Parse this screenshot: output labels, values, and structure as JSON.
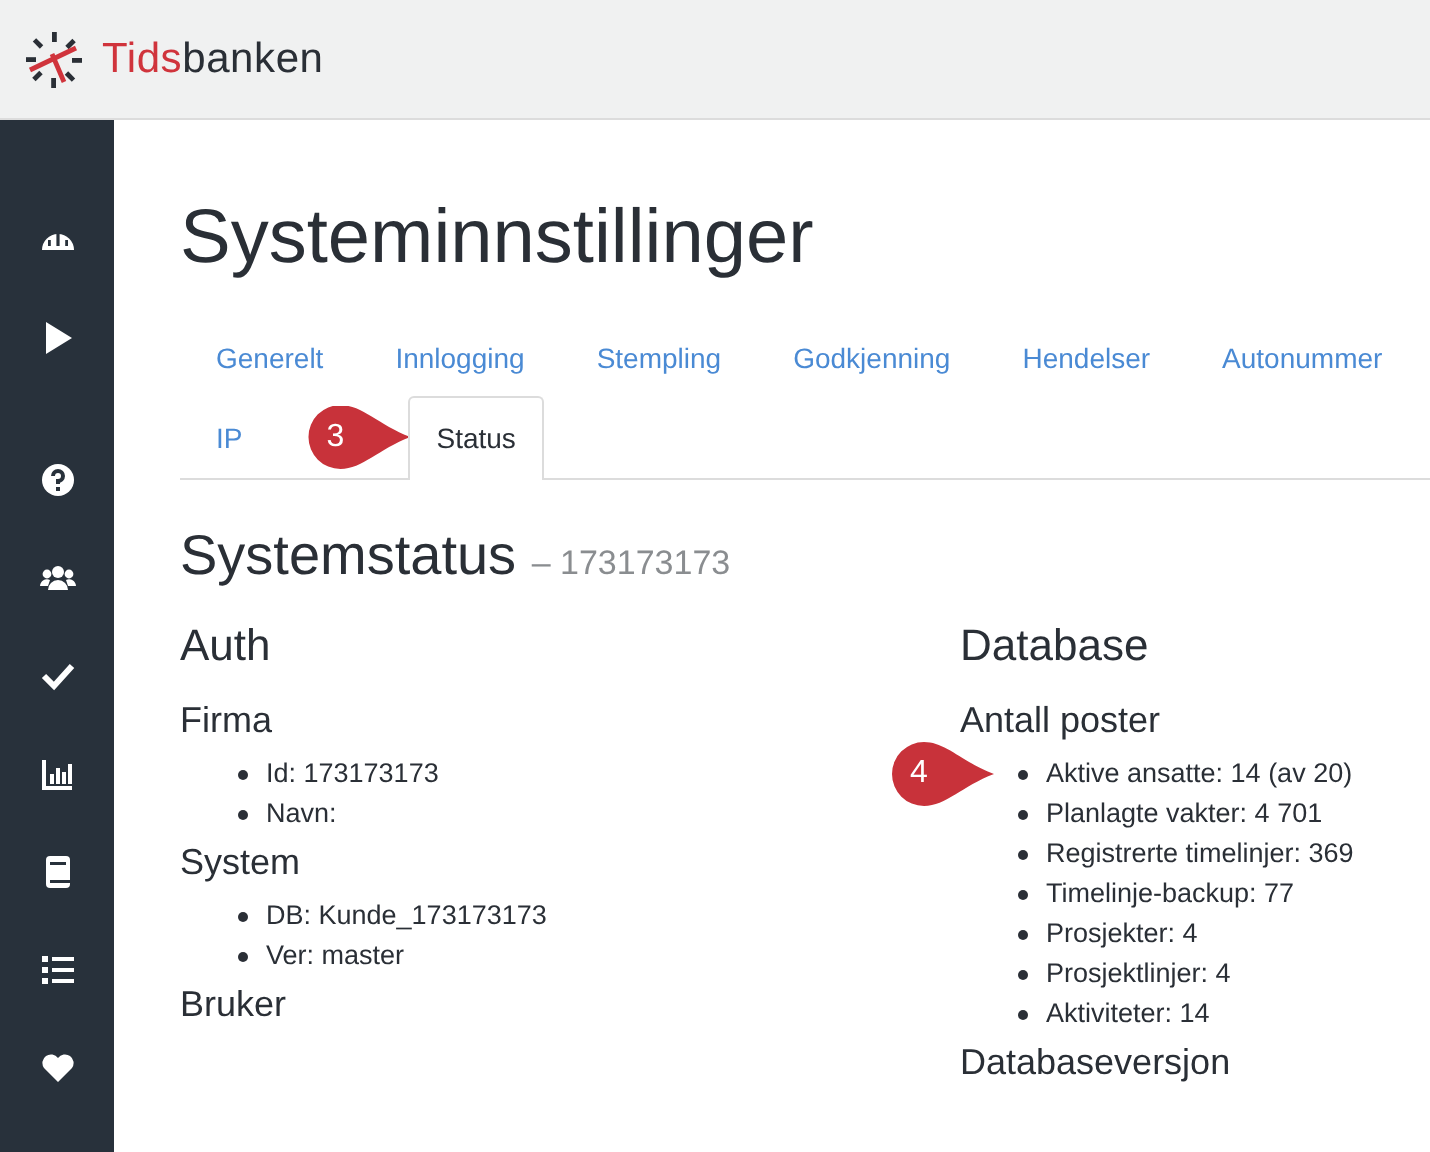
{
  "brand": {
    "name_red": "Tids",
    "name_dark": "banken"
  },
  "sidebar": {
    "items": [
      {
        "kind": "dashboard"
      },
      {
        "kind": "play"
      },
      {
        "kind": "help"
      },
      {
        "kind": "users"
      },
      {
        "kind": "check"
      },
      {
        "kind": "chart"
      },
      {
        "kind": "book"
      },
      {
        "kind": "list"
      },
      {
        "kind": "heart"
      }
    ]
  },
  "page_title": "Systeminnstillinger",
  "tabs": [
    {
      "label": "Generelt",
      "selected": false
    },
    {
      "label": "Innlogging",
      "selected": false
    },
    {
      "label": "Stempling",
      "selected": false
    },
    {
      "label": "Godkjenning",
      "selected": false
    },
    {
      "label": "Hendelser",
      "selected": false
    },
    {
      "label": "Autonummer",
      "selected": false
    },
    {
      "label": "IP",
      "selected": false
    },
    {
      "label": "Status",
      "selected": true,
      "callout": "3"
    }
  ],
  "section_title": "Systemstatus",
  "section_subtitle": "– 173173173",
  "columns": [
    {
      "title": "Auth",
      "groups": [
        {
          "title": "Firma",
          "items": [
            {
              "text": "Id: 173173173"
            },
            {
              "text": "Navn:"
            }
          ]
        },
        {
          "title": "System",
          "items": [
            {
              "text": "DB: Kunde_173173173"
            },
            {
              "text": "Ver: master"
            }
          ]
        },
        {
          "title": "Bruker"
        }
      ]
    },
    {
      "title": "Database",
      "groups": [
        {
          "title": "Antall poster",
          "items": [
            {
              "text": "Aktive ansatte: 14 (av 20)",
              "callout": "4"
            },
            {
              "text": "Planlagte vakter: 4 701"
            },
            {
              "text": "Registrerte timelinjer: 369"
            },
            {
              "text": "Timelinje-backup: 77"
            },
            {
              "text": "Prosjekter: 4"
            },
            {
              "text": "Prosjektlinjer: 4"
            },
            {
              "text": "Aktiviteter: 14"
            }
          ]
        },
        {
          "title": "Databaseversjon"
        }
      ]
    }
  ]
}
